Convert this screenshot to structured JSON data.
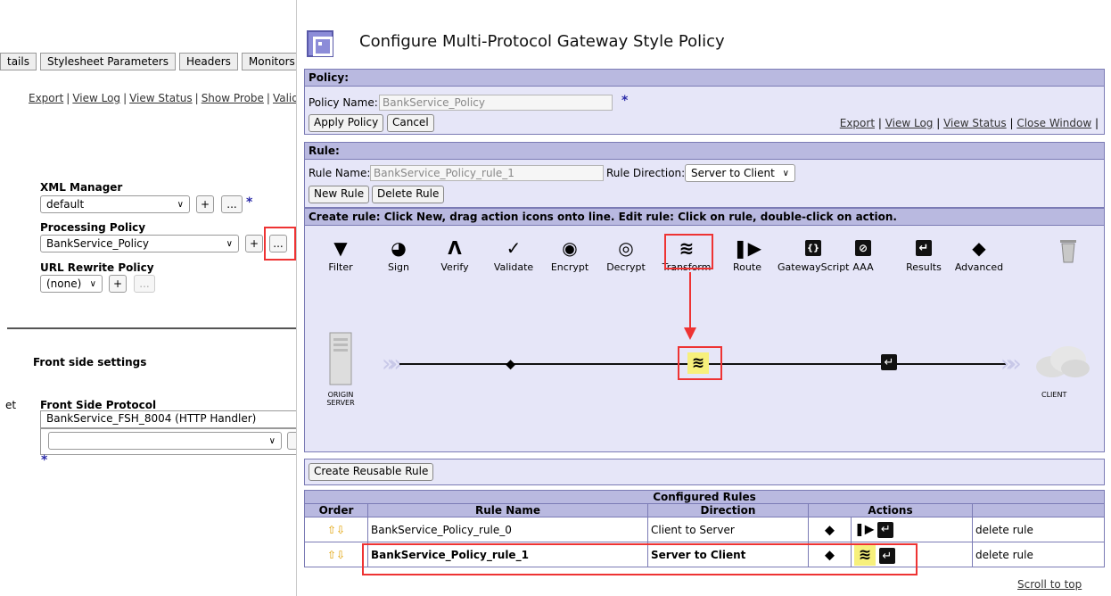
{
  "background_page": {
    "tabs": [
      "tails",
      "Stylesheet Parameters",
      "Headers",
      "Monitors"
    ],
    "links": [
      "Export",
      "View Log",
      "View Status",
      "Show Probe",
      "Valid"
    ],
    "xml_manager": {
      "label": "XML Manager",
      "value": "default"
    },
    "processing_policy": {
      "label": "Processing Policy",
      "value": "BankService_Policy"
    },
    "url_rewrite_policy": {
      "label": "URL Rewrite Policy",
      "value": "(none)"
    },
    "front_side_settings": "Front side settings",
    "left_stub": "et",
    "front_side_protocol": {
      "label": "Front Side Protocol",
      "value": "BankService_FSH_8004 (HTTP Handler)"
    },
    "plus": "+",
    "ellipsis": "...",
    "star": "*"
  },
  "dialog": {
    "title": "Configure Multi-Protocol Gateway Style Policy",
    "policy": {
      "header": "Policy:",
      "name_label": "Policy Name:",
      "name_value": "BankService_Policy",
      "apply_button": "Apply Policy",
      "cancel_button": "Cancel",
      "links": [
        "Export",
        "View Log",
        "View Status",
        "Close Window"
      ]
    },
    "rule": {
      "header": "Rule:",
      "name_label": "Rule Name:",
      "name_value": "BankService_Policy_rule_1",
      "direction_label": "Rule Direction:",
      "direction_value": "Server to Client",
      "new_button": "New Rule",
      "delete_button": "Delete Rule"
    },
    "instructions": "Create rule: Click New, drag action icons onto line.   Edit rule: Click on rule, double-click on action.",
    "palette": [
      "Filter",
      "Sign",
      "Verify",
      "Validate",
      "Encrypt",
      "Decrypt",
      "Transform",
      "Route",
      "GatewayScript",
      "AAA",
      "Results",
      "Advanced"
    ],
    "canvas": {
      "origin_label": [
        "ORIGIN",
        "SERVER"
      ],
      "client_label": "CLIENT"
    },
    "reusable_button": "Create Reusable Rule",
    "configured_rules": {
      "title": "Configured Rules",
      "headers": [
        "Order",
        "Rule Name",
        "Direction",
        "Actions"
      ],
      "rows": [
        {
          "name": "BankService_Policy_rule_0",
          "direction": "Client to Server",
          "delete": "delete rule"
        },
        {
          "name": "BankService_Policy_rule_1",
          "direction": "Server to Client",
          "delete": "delete rule"
        }
      ]
    },
    "scroll_to_top": "Scroll to top"
  },
  "colors": {
    "section_bg": "#e6e6f8",
    "section_head": "#b9b9e0",
    "highlight_red": "#e33333",
    "transform_yellow": "#f7f07c"
  }
}
